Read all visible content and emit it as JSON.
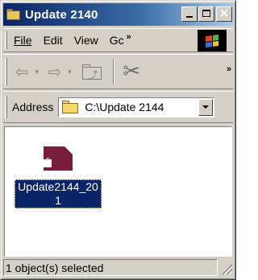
{
  "window": {
    "title": "Update 2140"
  },
  "menubar": {
    "items": [
      "File",
      "Edit",
      "View",
      "Gc"
    ],
    "overflow_glyph": "»"
  },
  "toolbar": {
    "back_glyph": "⇦",
    "forward_glyph": "⇨",
    "cut_glyph": "✂",
    "overflow_glyph": "»"
  },
  "address": {
    "label": "Address",
    "value": "C:\\Update 2144"
  },
  "files": [
    {
      "name": "Update2144_201",
      "selected": true
    }
  ],
  "status": {
    "text": "1 object(s) selected"
  },
  "colors": {
    "title_bar_start": "#0a246a",
    "title_bar_end": "#a6caf0",
    "selection": "#0a246a",
    "file_icon": "#7a1d3c",
    "chrome": "#d4d0c8"
  }
}
